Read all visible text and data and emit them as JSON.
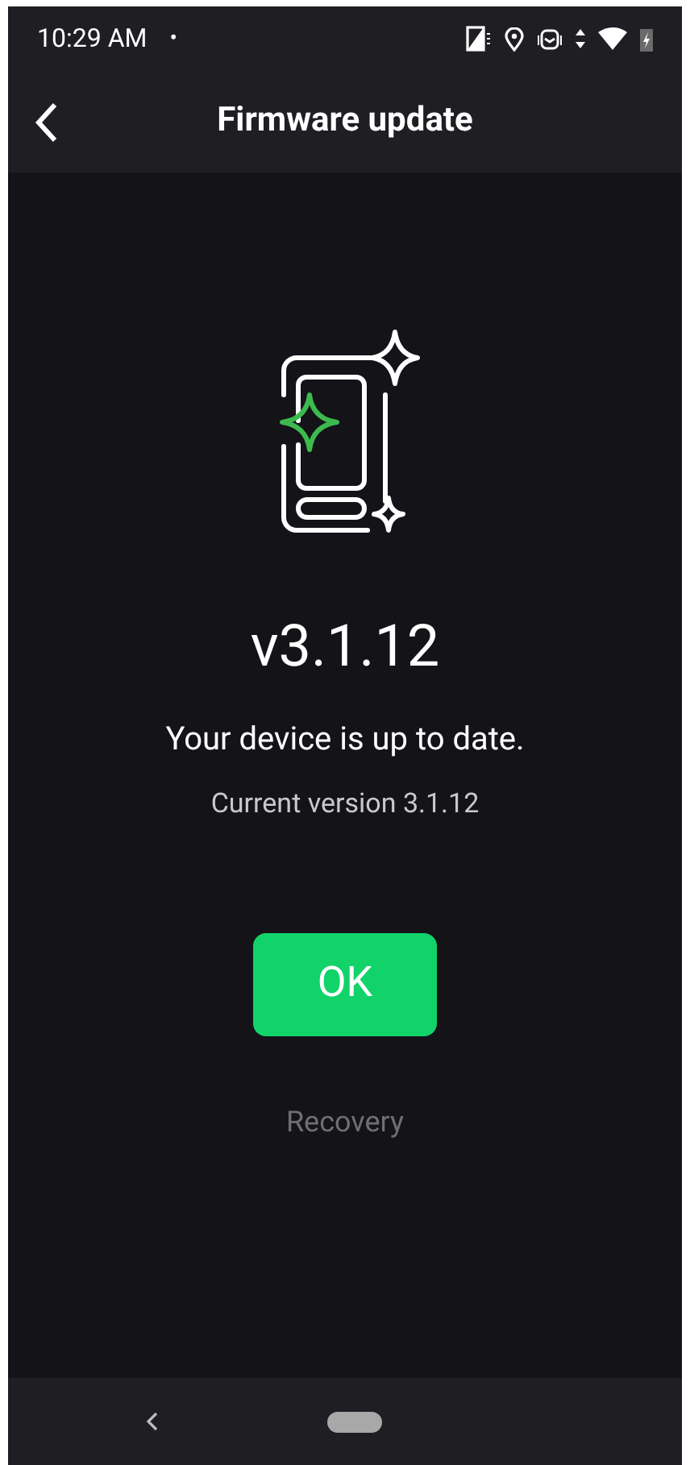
{
  "status_bar": {
    "time": "10:29 AM",
    "dot": "•"
  },
  "app_bar": {
    "title": "Firmware update"
  },
  "version": "v3.1.12",
  "message": "Your device is up to date.",
  "current_version": "Current version 3.1.12",
  "ok_button": "OK",
  "recovery_link": "Recovery"
}
